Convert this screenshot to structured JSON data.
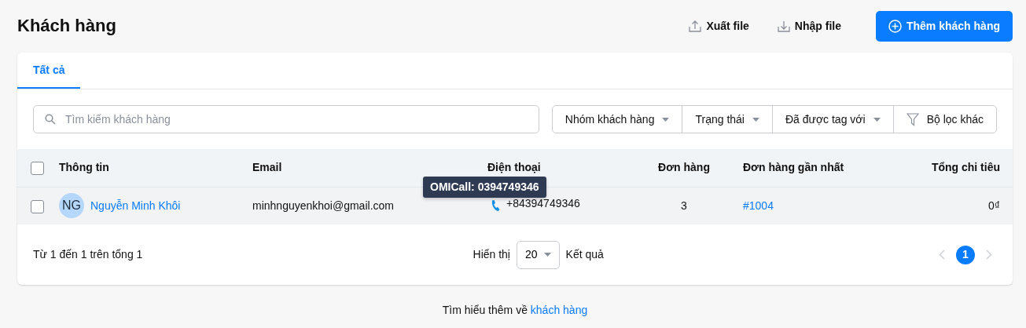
{
  "page": {
    "title": "Khách hàng"
  },
  "actions": [
    {
      "kind": "export",
      "label": "Xuất file"
    },
    {
      "kind": "import",
      "label": "Nhập file"
    },
    {
      "kind": "add",
      "label": "Thêm khách hàng"
    }
  ],
  "tabs": [
    {
      "label": "Tất cả",
      "selected": true
    }
  ],
  "search": {
    "placeholder": "Tìm kiếm khách hàng"
  },
  "filters": [
    {
      "kind": "dropdown",
      "label": "Nhóm khách hàng"
    },
    {
      "kind": "dropdown",
      "label": "Trạng thái"
    },
    {
      "kind": "dropdown",
      "label": "Đã được tag với"
    },
    {
      "kind": "filter",
      "label": "Bộ lọc khác"
    }
  ],
  "table": {
    "select_all": {
      "checked": false
    },
    "columns": [
      "Thông tin",
      "Email",
      "Điện thoại",
      "Đơn hàng",
      "Đơn hàng gần nhất",
      "Tổng chi tiêu"
    ],
    "rows": [
      {
        "checked": false,
        "initials": "NG",
        "name": "Nguyễn Minh Khôi",
        "email": "minhnguyenkhoi@gmail.com",
        "phone": "+84394749346",
        "orders": "3",
        "latest_order": "#1004",
        "total": "0₫"
      }
    ]
  },
  "tooltip": "OMICall: 0394749346",
  "pagination": {
    "summary": "Từ 1 đến 1 trên tổng 1",
    "show_label": "Hiển thị",
    "page_size": "20",
    "result_label": "Kết quả",
    "prev": {
      "disabled": true
    },
    "next": {
      "disabled": true
    },
    "pages": [
      {
        "label": "1",
        "selected": true
      }
    ]
  },
  "help": {
    "text": "Tìm hiểu thêm về",
    "link": "khách hàng"
  }
}
